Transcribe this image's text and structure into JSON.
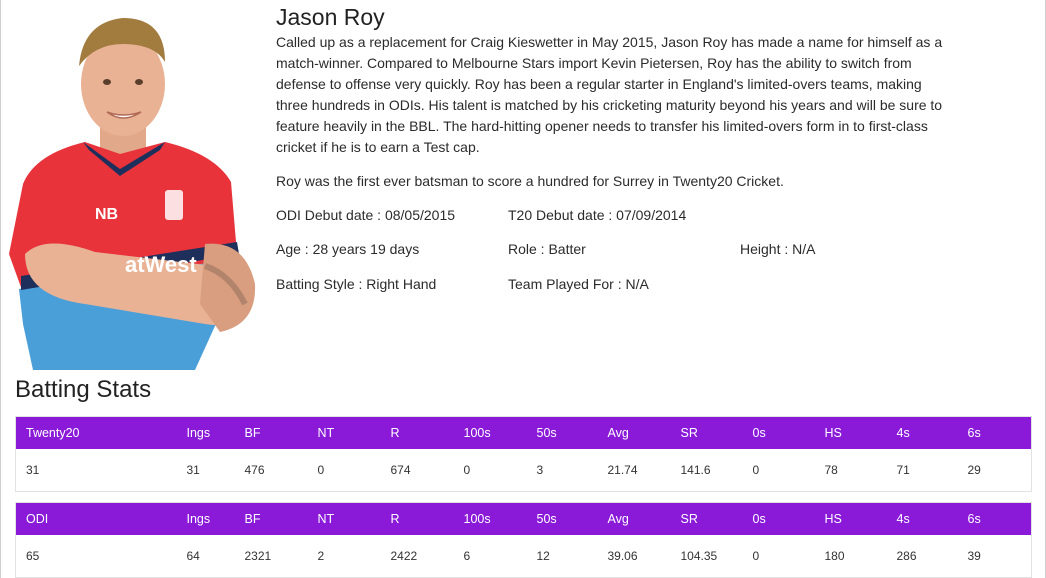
{
  "player": {
    "name": "Jason Roy",
    "bio_paragraph_1": "Called up as a replacement for Craig Kieswetter in May 2015, Jason Roy has made a name for himself as a match-winner.  Compared to Melbourne Stars import Kevin Pietersen, Roy has the ability to switch from defense to offense very quickly.  Roy has been a regular starter in England's limited-overs teams, making three hundreds in ODIs.   His talent is matched by his cricketing maturity beyond his years and will be sure to feature heavily in the BBL. The hard-hitting opener needs to transfer his limited-overs form in to first-class cricket if he is to earn a Test cap.",
    "bio_paragraph_2": "Roy was the first ever batsman to score a hundred for Surrey in Twenty20 Cricket.",
    "photo_sponsor_text": "atWest"
  },
  "info": {
    "odi_debut": "ODI Debut date : 08/05/2015",
    "t20_debut": "T20 Debut date : 07/09/2014",
    "age": "Age : 28 years 19 days",
    "role": "Role : Batter",
    "height": "Height : N/A",
    "batting_style": "Batting Style : Right Hand",
    "team": "Team Played For : N/A"
  },
  "batting_stats": {
    "title": "Batting Stats",
    "columns": [
      "Ings",
      "BF",
      "NT",
      "R",
      "100s",
      "50s",
      "Avg",
      "SR",
      "0s",
      "HS",
      "4s",
      "6s"
    ],
    "tables": [
      {
        "format": "Twenty20",
        "row": [
          "31",
          "31",
          "476",
          "0",
          "674",
          "0",
          "3",
          "21.74",
          "141.6",
          "0",
          "78",
          "71",
          "29"
        ]
      },
      {
        "format": "ODI",
        "row": [
          "65",
          "64",
          "2321",
          "2",
          "2422",
          "6",
          "12",
          "39.06",
          "104.35",
          "0",
          "180",
          "286",
          "39"
        ]
      }
    ]
  },
  "colors": {
    "header_bg": "#8a19d8",
    "header_text": "#ffffff",
    "shirt_red": "#e8333b",
    "shirt_blue": "#4b9fd9"
  }
}
